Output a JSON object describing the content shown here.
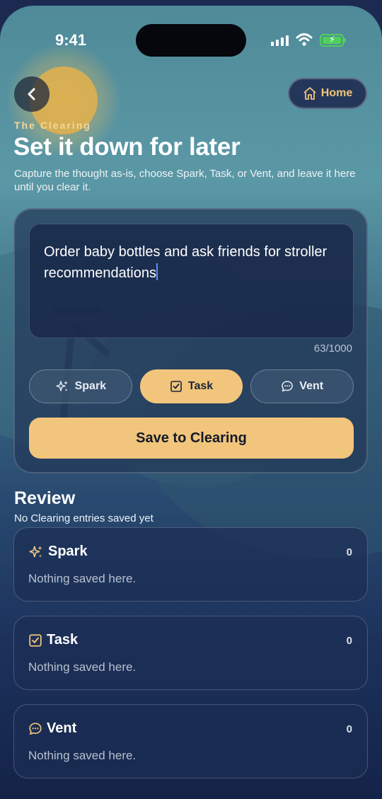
{
  "status_bar": {
    "time": "9:41"
  },
  "header": {
    "back_label": "Back",
    "home_label": "Home",
    "eyebrow": "The Clearing",
    "title": "Set it down for later",
    "subtitle": "Capture the thought as-is, choose Spark, Task, or Vent, and leave it here until you clear it."
  },
  "composer": {
    "text": "Order baby bottles and ask friends for stroller recommendations",
    "counter": "63/1000",
    "categories": [
      {
        "label": "Spark",
        "icon": "sparkles-icon",
        "selected": false
      },
      {
        "label": "Task",
        "icon": "checkbox-icon",
        "selected": true
      },
      {
        "label": "Vent",
        "icon": "chat-bubble-icon",
        "selected": false
      }
    ],
    "save_label": "Save to Clearing"
  },
  "review": {
    "title": "Review",
    "subtitle": "No Clearing entries saved yet",
    "sections": [
      {
        "label": "Spark",
        "icon": "sparkles-icon",
        "count": "0",
        "empty_text": "Nothing saved here."
      },
      {
        "label": "Task",
        "icon": "checkbox-icon",
        "count": "0",
        "empty_text": "Nothing saved here."
      },
      {
        "label": "Vent",
        "icon": "chat-bubble-icon",
        "count": "0",
        "empty_text": "Nothing saved here."
      }
    ]
  },
  "colors": {
    "accent": "#f2c57c",
    "eyebrow": "#f2d79a",
    "battery": "#4fd05c",
    "caret": "#5b8cff"
  }
}
